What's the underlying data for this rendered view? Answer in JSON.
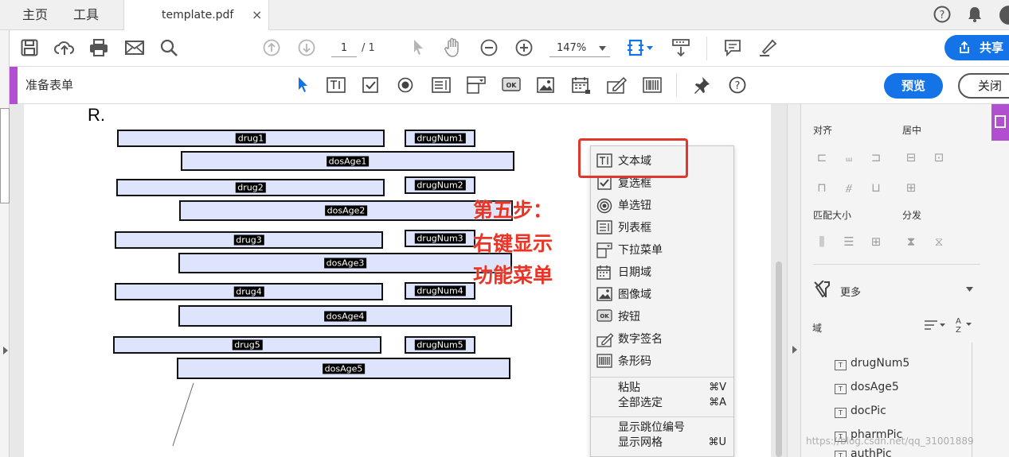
{
  "tabs": {
    "home": "主页",
    "tools": "工具",
    "document": "template.pdf",
    "close": "×"
  },
  "toolbar": {
    "page_current": "1",
    "page_total": "/ 1",
    "zoom": "147%",
    "share": "共享"
  },
  "form_bar": {
    "title": "准备表单",
    "preview": "预览",
    "close": "关闭"
  },
  "page": {
    "letter": "R.",
    "fields": [
      {
        "label": "drug1"
      },
      {
        "label": "drugNum1"
      },
      {
        "label": "dosAge1"
      },
      {
        "label": "drug2"
      },
      {
        "label": "drugNum2"
      },
      {
        "label": "dosAge2"
      },
      {
        "label": "drug3"
      },
      {
        "label": "drugNum3"
      },
      {
        "label": "dosAge3"
      },
      {
        "label": "drug4"
      },
      {
        "label": "drugNum4"
      },
      {
        "label": "dosAge4"
      },
      {
        "label": "drug5"
      },
      {
        "label": "drugNum5"
      },
      {
        "label": "dosAge5"
      }
    ]
  },
  "context_menu": {
    "items": [
      {
        "label": "文本域",
        "icon": "text-field-icon"
      },
      {
        "label": "复选框",
        "icon": "checkbox-icon"
      },
      {
        "label": "单选钮",
        "icon": "radio-icon"
      },
      {
        "label": "列表框",
        "icon": "list-box-icon"
      },
      {
        "label": "下拉菜单",
        "icon": "dropdown-icon"
      },
      {
        "label": "日期域",
        "icon": "calendar-icon"
      },
      {
        "label": "图像域",
        "icon": "image-icon"
      },
      {
        "label": "按钮",
        "icon": "ok-button-icon"
      },
      {
        "label": "数字签名",
        "icon": "signature-icon"
      },
      {
        "label": "条形码",
        "icon": "barcode-icon"
      }
    ],
    "paste": {
      "label": "粘贴",
      "shortcut": "⌘V"
    },
    "select_all": {
      "label": "全部选定",
      "shortcut": "⌘A"
    },
    "show_tab_order": {
      "label": "显示跳位编号"
    },
    "show_grid": {
      "label": "显示网格",
      "shortcut": "⌘U"
    }
  },
  "annotation": {
    "line1": "第五步：",
    "line2": "右键显示",
    "line3": "功能菜单",
    "color": "#ec3326"
  },
  "right_panel": {
    "align": "对齐",
    "center": "居中",
    "match_size": "匹配大小",
    "distribute": "分发",
    "more": "更多",
    "fields": "域",
    "field_list": [
      "drugNum5",
      "dosAge5",
      "docPic",
      "pharmPic",
      "authPic"
    ]
  },
  "watermark": "https://blog.csdn.net/qq_31001889",
  "colors": {
    "accent": "#1473e6",
    "form_accent": "#b24fd0",
    "field_fill": "#dde4fb"
  }
}
